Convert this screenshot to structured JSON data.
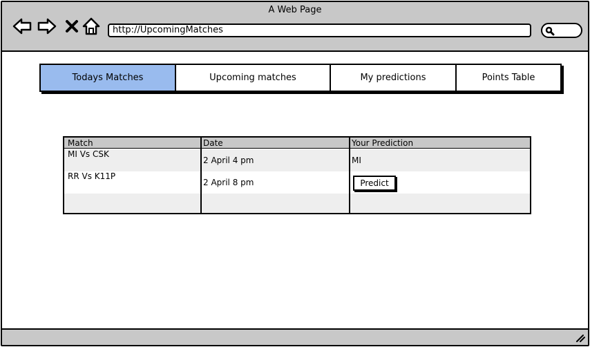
{
  "window": {
    "title": "A Web Page"
  },
  "browser": {
    "url": "http://UpcomingMatches",
    "icons": [
      "back-arrow-icon",
      "forward-arrow-icon",
      "close-x-icon",
      "home-icon",
      "search-icon"
    ]
  },
  "tabs": [
    {
      "label": "Todays Matches",
      "active": true
    },
    {
      "label": "Upcoming matches",
      "active": false
    },
    {
      "label": "My predictions",
      "active": false
    },
    {
      "label": "Points Table",
      "active": false
    }
  ],
  "table": {
    "headers": [
      "Match",
      "Date",
      "Your Prediction"
    ],
    "rows": [
      {
        "match": "MI Vs CSK",
        "date": "2 April 4 pm",
        "prediction": "MI"
      },
      {
        "match": "RR Vs K11P",
        "date": "2 April 8 pm",
        "prediction_button": "Predict"
      }
    ]
  },
  "colors": {
    "chrome": "#c8c8c8",
    "active_tab": "#99bbee",
    "alt_row": "#eeeeee"
  }
}
